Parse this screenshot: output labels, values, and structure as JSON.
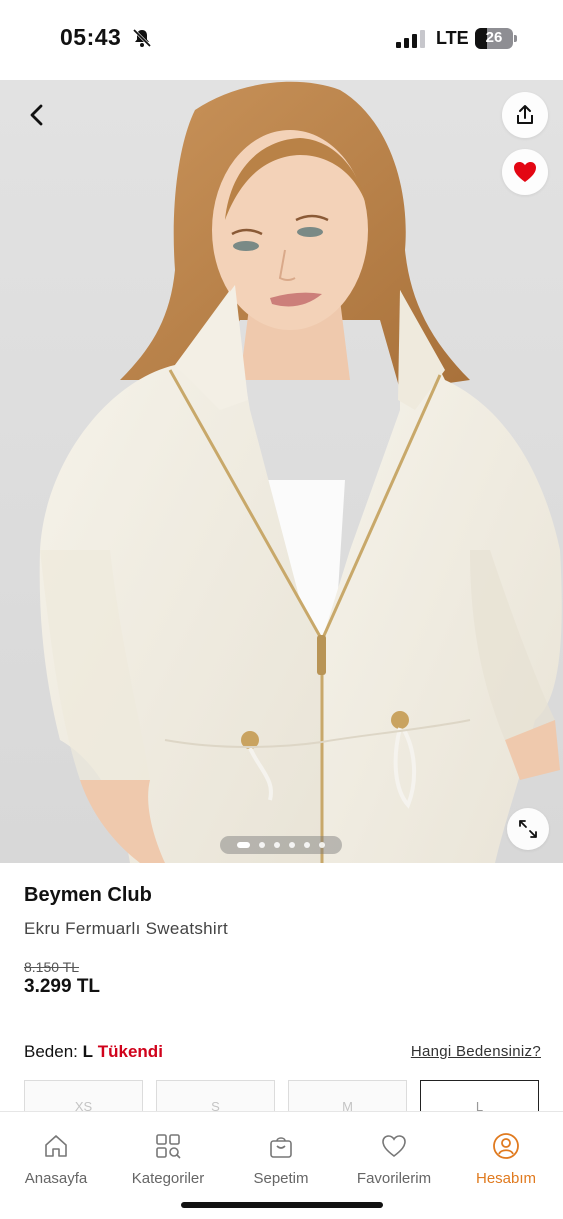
{
  "status": {
    "time": "05:43",
    "network": "LTE",
    "battery": "26",
    "bell_icon": "bell-slash-icon",
    "signal_icon": "signal-bars-icon"
  },
  "gallery": {
    "back_icon": "chevron-left-icon",
    "share_icon": "share-icon",
    "favorite_icon": "heart-filled-icon",
    "expand_icon": "expand-icon",
    "image_count": 6,
    "active_index": 0,
    "accent_favorite": "#e30613"
  },
  "product": {
    "brand": "Beymen Club",
    "name": "Ekru Fermuarlı Sweatshirt",
    "old_price": "8.150 TL",
    "price": "3.299 TL"
  },
  "size": {
    "label": "Beden:",
    "selected": "L",
    "stock_status": "Tükendi",
    "stock_color": "#d0021b",
    "guide_link": "Hangi Bedensiniz?",
    "options": [
      "XS",
      "S",
      "M",
      "L"
    ],
    "selected_option": "L"
  },
  "nav": {
    "items": [
      {
        "label": "Anasayfa",
        "icon": "home-icon"
      },
      {
        "label": "Kategoriler",
        "icon": "categories-icon"
      },
      {
        "label": "Sepetim",
        "icon": "shopping-bag-icon"
      },
      {
        "label": "Favorilerim",
        "icon": "heart-outline-icon"
      },
      {
        "label": "Hesabım",
        "icon": "account-icon"
      }
    ],
    "active": "Hesabım",
    "accent": "#e07a1f"
  }
}
